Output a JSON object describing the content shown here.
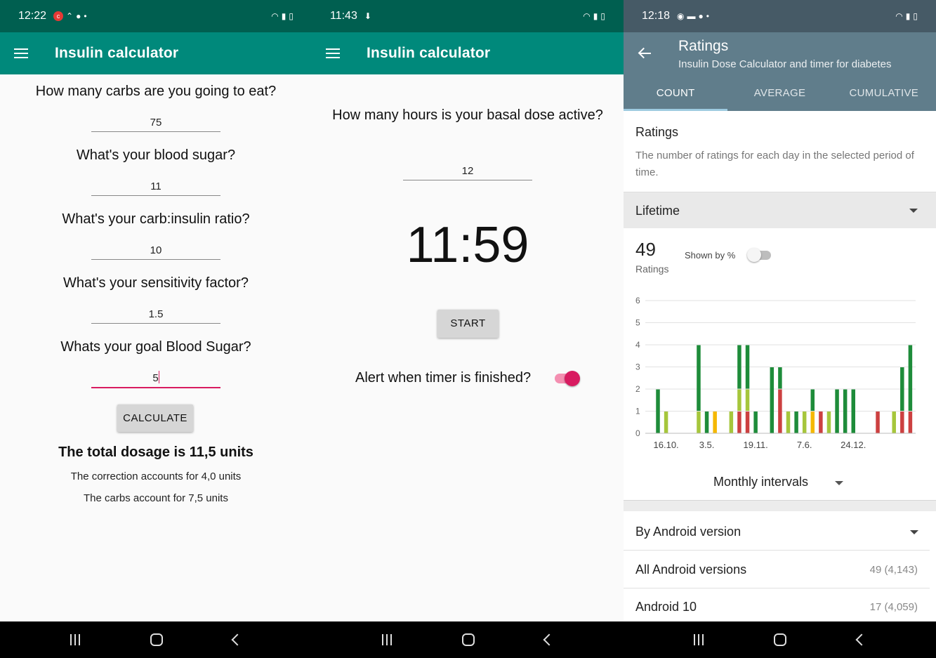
{
  "panel1": {
    "status": {
      "time": "12:22"
    },
    "title": "Insulin calculator",
    "questions": [
      {
        "label": "How many carbs are you going to eat?",
        "value": "75"
      },
      {
        "label": "What's your blood sugar?",
        "value": "11"
      },
      {
        "label": "What's your carb:insulin ratio?",
        "value": "10"
      },
      {
        "label": "What's your sensitivity factor?",
        "value": "1.5"
      },
      {
        "label": "Whats your goal Blood Sugar?",
        "value": "5"
      }
    ],
    "calculate_label": "CALCULATE",
    "result": "The total dosage is 11,5 units",
    "correction": "The correction accounts for 4,0 units",
    "carbs": "The carbs account for 7,5 units"
  },
  "panel2": {
    "status": {
      "time": "11:43"
    },
    "title": "Insulin calculator",
    "question": "How many hours is your basal dose active?",
    "hours_value": "12",
    "clock": "11:59",
    "start_label": "START",
    "alert_label": "Alert when timer is finished?",
    "alert_on": true
  },
  "panel3": {
    "status": {
      "time": "12:18"
    },
    "title": "Ratings",
    "subtitle": "Insulin Dose Calculator and timer for diabetes",
    "tabs": [
      "COUNT",
      "AVERAGE",
      "CUMULATIVE"
    ],
    "section_title": "Ratings",
    "section_desc": "The number of ratings for each day in the selected period of time.",
    "period": "Lifetime",
    "total": "49",
    "total_label": "Ratings",
    "shown_by": "Shown by %",
    "intervals": "Monthly intervals",
    "by_version": "By Android version",
    "rows": [
      {
        "label": "All Android versions",
        "count": "49 (4,143)"
      },
      {
        "label": "Android 10",
        "count": "17 (4,059)"
      }
    ]
  },
  "chart_data": {
    "type": "bar",
    "stacked": true,
    "ylim": [
      0,
      6
    ],
    "yticks": [
      0,
      1,
      2,
      3,
      4,
      5,
      6
    ],
    "xticks": [
      {
        "label": "16.10.",
        "index": 1
      },
      {
        "label": "3.5.",
        "index": 6
      },
      {
        "label": "19.11.",
        "index": 12
      },
      {
        "label": "7.6.",
        "index": 18
      },
      {
        "label": "24.12.",
        "index": 24
      }
    ],
    "colors": {
      "dark_green": "#1e8c3a",
      "light_green": "#a6c63c",
      "yellow": "#f5b800",
      "red": "#cc4040"
    },
    "bars": [
      [
        {
          "c": "dark_green",
          "v": 2
        }
      ],
      [
        {
          "c": "light_green",
          "v": 1
        }
      ],
      [],
      [],
      [],
      [
        {
          "c": "light_green",
          "v": 1
        },
        {
          "c": "dark_green",
          "v": 3
        }
      ],
      [
        {
          "c": "dark_green",
          "v": 1
        }
      ],
      [
        {
          "c": "yellow",
          "v": 1
        }
      ],
      [],
      [
        {
          "c": "light_green",
          "v": 1
        }
      ],
      [
        {
          "c": "red",
          "v": 1
        },
        {
          "c": "light_green",
          "v": 1
        },
        {
          "c": "dark_green",
          "v": 2
        }
      ],
      [
        {
          "c": "red",
          "v": 1
        },
        {
          "c": "light_green",
          "v": 1
        },
        {
          "c": "dark_green",
          "v": 2
        }
      ],
      [
        {
          "c": "dark_green",
          "v": 1
        }
      ],
      [],
      [
        {
          "c": "dark_green",
          "v": 3
        }
      ],
      [
        {
          "c": "red",
          "v": 2
        },
        {
          "c": "dark_green",
          "v": 1
        }
      ],
      [
        {
          "c": "light_green",
          "v": 1
        }
      ],
      [
        {
          "c": "dark_green",
          "v": 1
        }
      ],
      [
        {
          "c": "light_green",
          "v": 1
        }
      ],
      [
        {
          "c": "yellow",
          "v": 1
        },
        {
          "c": "dark_green",
          "v": 1
        }
      ],
      [
        {
          "c": "red",
          "v": 1
        }
      ],
      [
        {
          "c": "light_green",
          "v": 1
        }
      ],
      [
        {
          "c": "dark_green",
          "v": 2
        }
      ],
      [
        {
          "c": "dark_green",
          "v": 2
        }
      ],
      [
        {
          "c": "dark_green",
          "v": 2
        }
      ],
      [],
      [],
      [
        {
          "c": "red",
          "v": 1
        }
      ],
      [],
      [
        {
          "c": "light_green",
          "v": 1
        }
      ],
      [
        {
          "c": "red",
          "v": 1
        },
        {
          "c": "dark_green",
          "v": 2
        }
      ],
      [
        {
          "c": "red",
          "v": 1
        },
        {
          "c": "dark_green",
          "v": 3
        }
      ]
    ]
  }
}
